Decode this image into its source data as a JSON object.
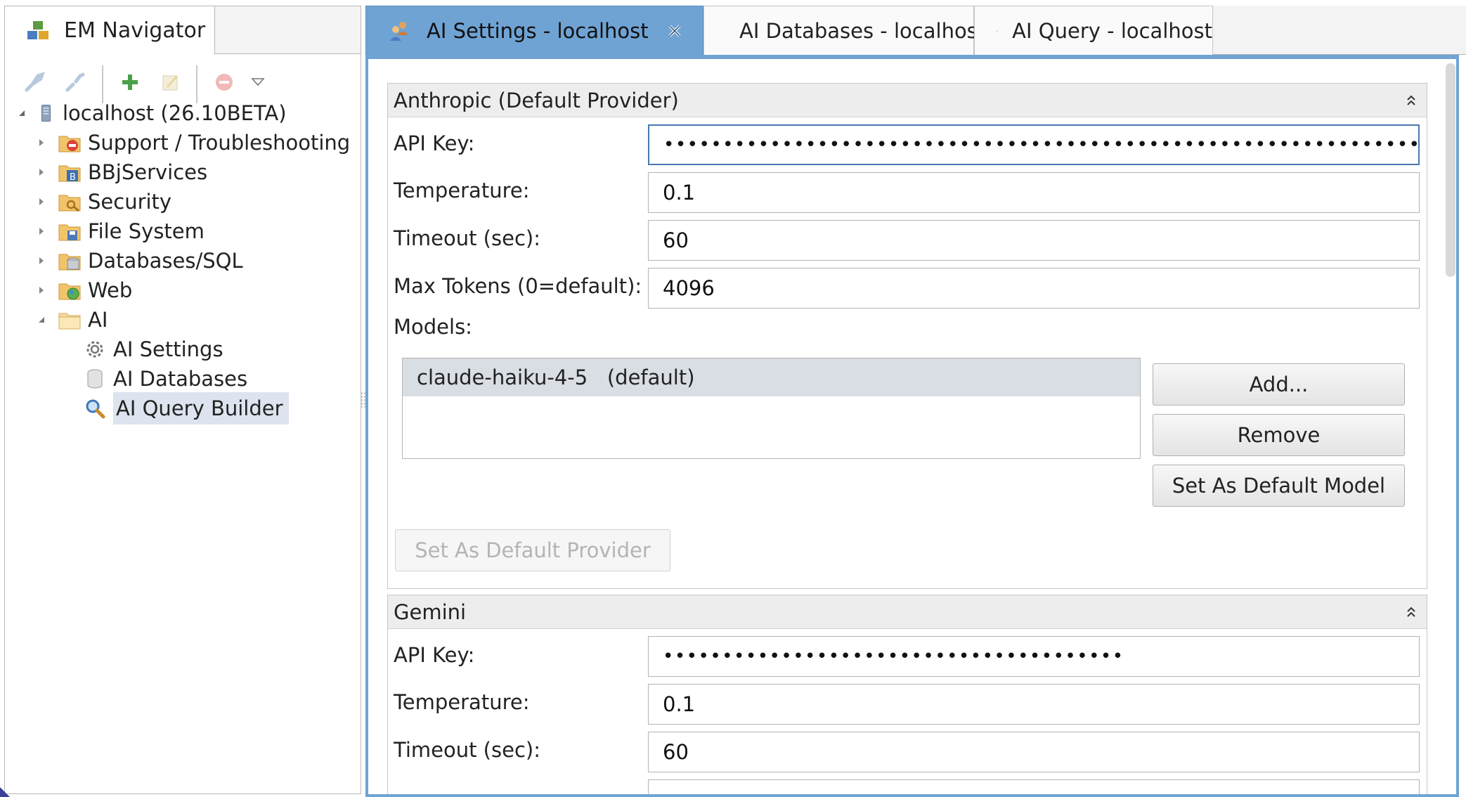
{
  "navigator": {
    "tab_title": "EM Navigator",
    "toolbar": {
      "icons": [
        "connect-icon",
        "disconnect-icon",
        "add-icon",
        "edit-icon",
        "remove-icon",
        "view-menu-icon"
      ]
    },
    "tree": {
      "root": "localhost (26.10BETA)",
      "items": [
        {
          "label": "Support / Troubleshooting",
          "icon": "support-folder-icon"
        },
        {
          "label": "BBjServices",
          "icon": "bbjservices-folder-icon"
        },
        {
          "label": "Security",
          "icon": "security-folder-icon"
        },
        {
          "label": "File System",
          "icon": "filesystem-folder-icon"
        },
        {
          "label": "Databases/SQL",
          "icon": "database-folder-icon"
        },
        {
          "label": "Web",
          "icon": "web-folder-icon"
        },
        {
          "label": "AI",
          "icon": "ai-folder-icon"
        }
      ],
      "ai_children": [
        {
          "label": "AI Settings",
          "icon": "gear-icon"
        },
        {
          "label": "AI Databases",
          "icon": "database-icon"
        },
        {
          "label": "AI Query Builder",
          "icon": "magnifier-icon",
          "selected": true
        }
      ]
    }
  },
  "editor": {
    "tabs": [
      {
        "label": "AI Settings - localhost",
        "active": true,
        "closable": true
      },
      {
        "label": "AI Databases - localhost",
        "active": false
      },
      {
        "label": "AI Query - localhost",
        "active": false
      }
    ],
    "anthropic": {
      "title": "Anthropic (Default Provider)",
      "api_key_label": "API Key:",
      "api_key_value": "••••••••••••••••••••••••••••••••••••••••••••••••••••••••••••••••••••••••••••••",
      "temperature_label": "Temperature:",
      "temperature_value": "0.1",
      "timeout_label": "Timeout (sec):",
      "timeout_value": "60",
      "max_tokens_label": "Max Tokens (0=default):",
      "max_tokens_value": "4096",
      "models_label": "Models:",
      "models": [
        "claude-haiku-4-5   (default)"
      ],
      "add_button": "Add...",
      "remove_button": "Remove",
      "set_default_model_button": "Set As Default Model",
      "set_default_provider_button": "Set As Default Provider"
    },
    "gemini": {
      "title": "Gemini",
      "api_key_label": "API Key:",
      "api_key_value": "•••••••••••••••••••••••••••••••••••••••",
      "temperature_label": "Temperature:",
      "temperature_value": "0.1",
      "timeout_label": "Timeout (sec):",
      "timeout_value": "60"
    }
  },
  "colors": {
    "active_tab": "#6fa3d4",
    "selection": "#dde4ef",
    "section_header": "#ededed"
  }
}
